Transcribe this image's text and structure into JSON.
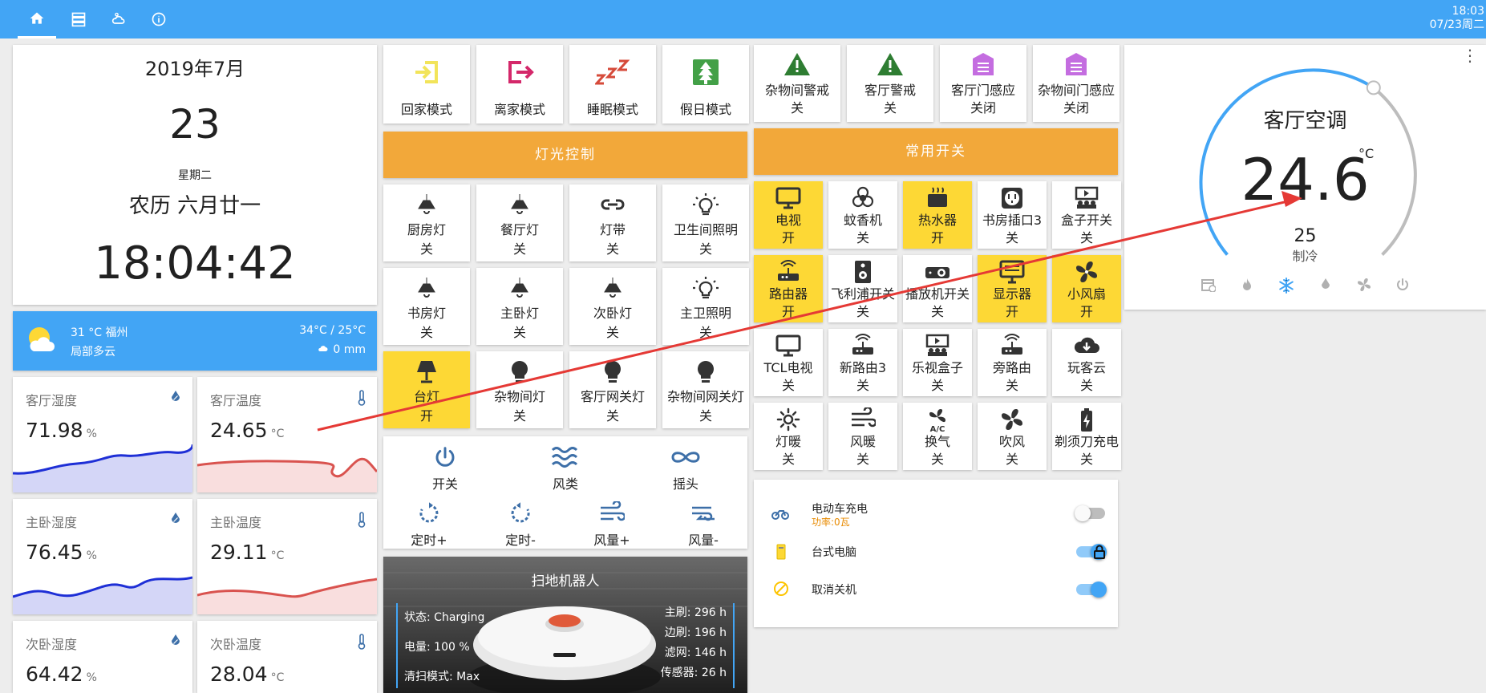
{
  "topbar": {
    "time": "18:03",
    "date": "07/23周二"
  },
  "date_card": {
    "month": "2019年7月",
    "day": "23",
    "weekday": "星期二",
    "lunar": "农历 六月廿一",
    "time": "18:04:42"
  },
  "weather": {
    "temp_city": "31 °C 福州",
    "condition": "局部多云",
    "range": "34°C / 25°C",
    "rain": "0 mm"
  },
  "sensors": [
    {
      "title": "客厅湿度",
      "value": "71.98",
      "unit": "%"
    },
    {
      "title": "客厅温度",
      "value": "24.65",
      "unit": "°C"
    },
    {
      "title": "主卧湿度",
      "value": "76.45",
      "unit": "%"
    },
    {
      "title": "主卧温度",
      "value": "29.11",
      "unit": "°C"
    },
    {
      "title": "次卧湿度",
      "value": "64.42",
      "unit": "%"
    },
    {
      "title": "次卧温度",
      "value": "28.04",
      "unit": "°C"
    }
  ],
  "modes": [
    {
      "label": "回家模式"
    },
    {
      "label": "离家模式"
    },
    {
      "label": "睡眠模式"
    },
    {
      "label": "假日模式"
    }
  ],
  "light_banner": "灯光控制",
  "lights": [
    {
      "name": "厨房灯",
      "state": "关"
    },
    {
      "name": "餐厅灯",
      "state": "关"
    },
    {
      "name": "灯带",
      "state": "关"
    },
    {
      "name": "卫生间照明",
      "state": "关"
    },
    {
      "name": "书房灯",
      "state": "关"
    },
    {
      "name": "主卧灯",
      "state": "关"
    },
    {
      "name": "次卧灯",
      "state": "关"
    },
    {
      "name": "主卫照明",
      "state": "关"
    },
    {
      "name": "台灯",
      "state": "开"
    },
    {
      "name": "杂物间灯",
      "state": "关"
    },
    {
      "name": "客厅网关灯",
      "state": "关"
    },
    {
      "name": "杂物间网关灯",
      "state": "关"
    }
  ],
  "fan": {
    "power": "开关",
    "wind_type": "风类",
    "oscillate": "摇头",
    "timer_plus": "定时+",
    "timer_minus": "定时-",
    "speed_plus": "风量+",
    "speed_minus": "风量-"
  },
  "robot": {
    "title": "扫地机器人",
    "status": "状态: Charging",
    "battery": "电量: 100 %",
    "mode": "清扫模式: Max",
    "main_brush": "主刷: 296 h",
    "side_brush": "边刷: 196 h",
    "filter": "滤网: 146 h",
    "sensor": "传感器: 26 h"
  },
  "alarms": [
    {
      "name": "杂物间警戒",
      "state": "关"
    },
    {
      "name": "客厅警戒",
      "state": "关"
    },
    {
      "name": "客厅门感应",
      "state": "关闭"
    },
    {
      "name": "杂物间门感应",
      "state": "关闭"
    }
  ],
  "switch_banner": "常用开关",
  "switches": [
    {
      "name": "电视",
      "state": "开"
    },
    {
      "name": "蚊香机",
      "state": "关"
    },
    {
      "name": "热水器",
      "state": "开"
    },
    {
      "name": "书房插口3",
      "state": "关"
    },
    {
      "name": "盒子开关",
      "state": "关"
    },
    {
      "name": "路由器",
      "state": "开"
    },
    {
      "name": "飞利浦开关",
      "state": "关"
    },
    {
      "name": "播放机开关",
      "state": "关"
    },
    {
      "name": "显示器",
      "state": "开"
    },
    {
      "name": "小风扇",
      "state": "开"
    },
    {
      "name": "TCL电视",
      "state": "关"
    },
    {
      "name": "新路由3",
      "state": "关"
    },
    {
      "name": "乐视盒子",
      "state": "关"
    },
    {
      "name": "旁路由",
      "state": "关"
    },
    {
      "name": "玩客云",
      "state": "关"
    },
    {
      "name": "灯暖",
      "state": "关"
    },
    {
      "name": "风暖",
      "state": "关"
    },
    {
      "name": "换气",
      "state": "关"
    },
    {
      "name": "吹风",
      "state": "关"
    },
    {
      "name": "剃须刀充电",
      "state": "关"
    }
  ],
  "entities": [
    {
      "name": "电动车充电",
      "sub": "功率:0瓦",
      "on": false
    },
    {
      "name": "台式电脑",
      "on": true
    },
    {
      "name": "取消关机",
      "on": true
    }
  ],
  "thermostat": {
    "name": "客厅空调",
    "current": "24.6",
    "unit": "°C",
    "target": "25",
    "mode": "制冷"
  },
  "colors": {
    "accent": "#42a5f5",
    "on_tile": "#fdd835",
    "banner": "#f2a83a",
    "chart_line_blue": "#1e2fd6",
    "chart_line_red": "#d9534f"
  }
}
